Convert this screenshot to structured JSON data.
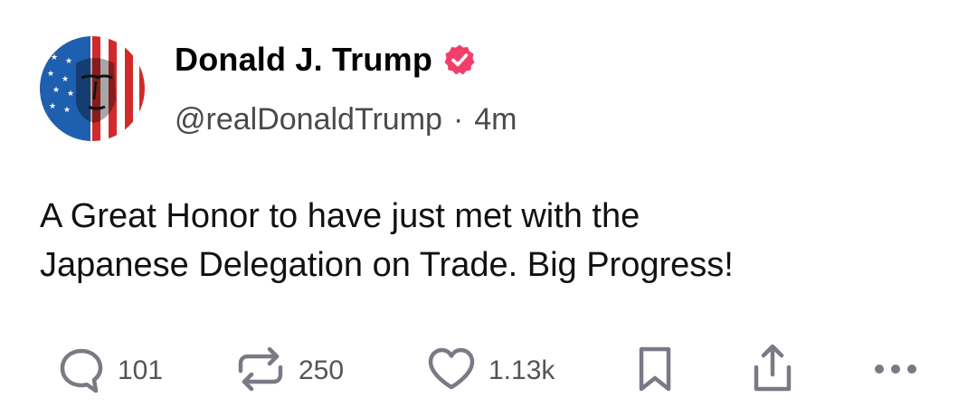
{
  "post": {
    "author": {
      "display_name": "Donald J. Trump",
      "handle": "@realDonaldTrump",
      "verified": true,
      "verified_color": "#f23e6a"
    },
    "time_separator": "·",
    "timestamp": "4m",
    "text_line_1": "A Great Honor to have just met with the",
    "text_line_2": "Japanese Delegation on Trade. Big Progress!",
    "actions": {
      "replies": "101",
      "reposts": "250",
      "likes": "1.13k"
    }
  },
  "icons": {
    "reply": "reply-icon",
    "repost": "repost-icon",
    "like": "heart-icon",
    "bookmark": "bookmark-icon",
    "share": "share-icon",
    "more": "more-icon"
  },
  "colors": {
    "icon": "#7a7a86",
    "count": "#555555",
    "handle": "#4a4a4a"
  }
}
